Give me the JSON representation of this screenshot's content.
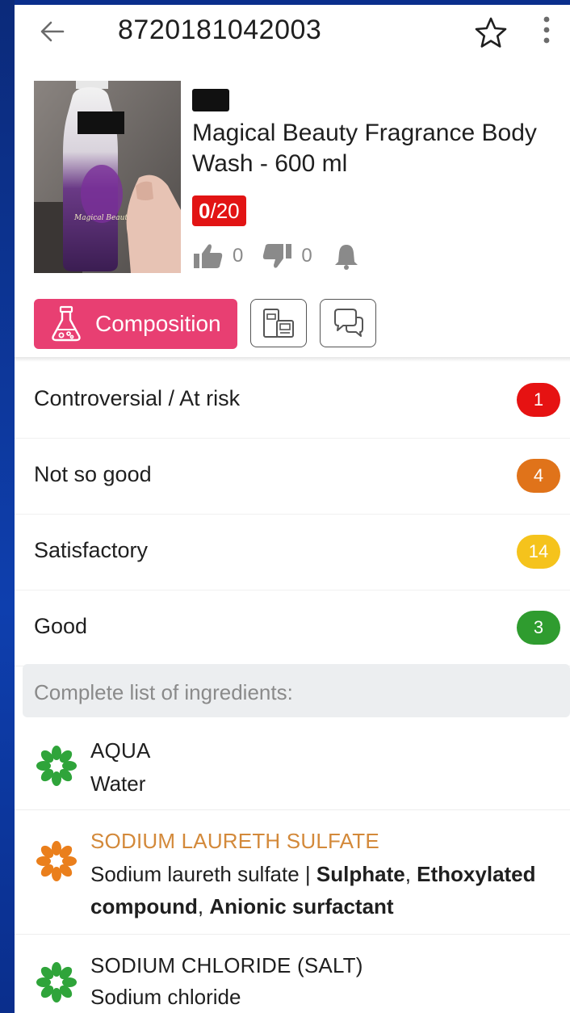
{
  "header": {
    "barcode": "8720181042003"
  },
  "product": {
    "name": "Magical Beauty Fragrance Body Wash - 600 ml",
    "score_value": "0",
    "score_total": "/20",
    "likes": "0",
    "dislikes": "0"
  },
  "tabs": {
    "composition_label": "Composition"
  },
  "categories": [
    {
      "label": "Controversial / At risk",
      "count": "1",
      "color": "#e61212"
    },
    {
      "label": "Not so good",
      "count": "4",
      "color": "#e0731a"
    },
    {
      "label": "Satisfactory",
      "count": "14",
      "color": "#f5c31c"
    },
    {
      "label": "Good",
      "count": "3",
      "color": "#2f9c2f"
    }
  ],
  "ingredients_header": "Complete list of ingredients:",
  "ingredients": [
    {
      "name": "AQUA",
      "description_plain": "Water",
      "icon": "green-flower-icon",
      "icon_color": "#2fa43a"
    },
    {
      "name": "SODIUM LAURETH SULFATE",
      "description_plain": "Sodium laureth sulfate | ",
      "tag_1": "Sulphate",
      "sep_1": ", ",
      "tag_2": "Ethoxylated compound",
      "sep_2": ", ",
      "tag_3": "Anionic surfactant",
      "icon": "orange-flower-icon",
      "icon_color": "#ea7f1c"
    },
    {
      "name": "SODIUM CHLORIDE (SALT)",
      "description_plain": "Sodium chloride",
      "icon": "green-flower-icon",
      "icon_color": "#2fa43a"
    }
  ]
}
